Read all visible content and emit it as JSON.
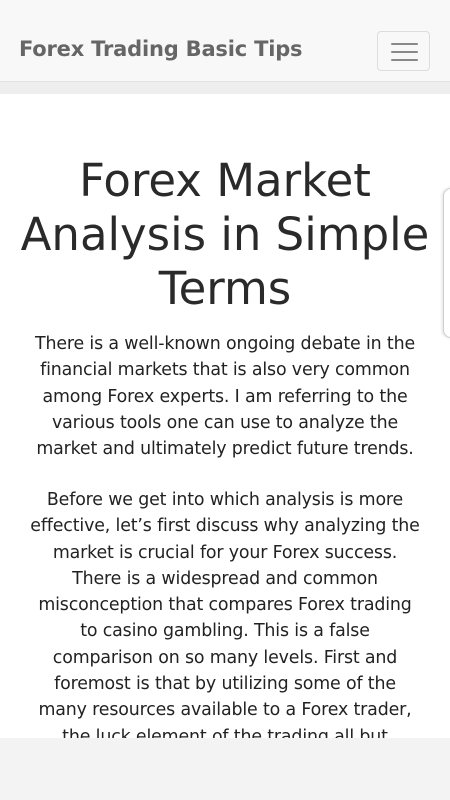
{
  "navbar": {
    "brand": "Forex Trading Basic Tips",
    "menu_icon": "hamburger-menu-icon"
  },
  "article": {
    "title": "Forex Market Analysis in Simple Terms",
    "paragraphs": [
      "There is a well-known ongoing debate in the financial markets that is also very common among Forex experts. I am referring to the various tools one can use to analyze the market and ultimately predict future trends.",
      "Before we get into which analysis is more effective, let’s first discuss why analyzing the market is crucial for your Forex success. There is a widespread and common misconception that compares Forex trading to casino gambling. This is a false comparison on so many levels.  First and foremost is that by utilizing some of the many resources available to a Forex trader, the luck element of the trading all but"
    ]
  },
  "colors": {
    "navbar_bg": "#f8f8f8",
    "brand_text": "#666666",
    "body_text": "#222222"
  }
}
